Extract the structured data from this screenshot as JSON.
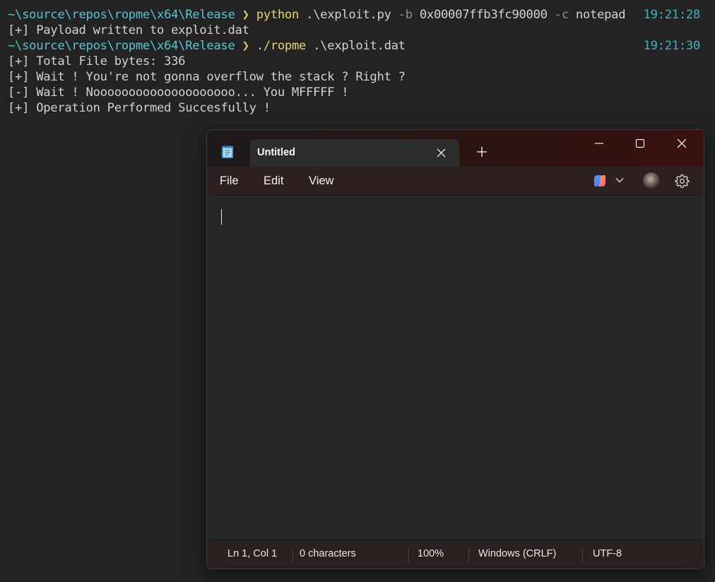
{
  "terminal": {
    "lines": [
      {
        "path": "~\\source\\repos\\ropme\\x64\\Release",
        "arrow": "❯",
        "cmd": "python",
        "args": " .\\exploit.py ",
        "flag1": "-b",
        "args2": " 0x00007ffb3fc90000 ",
        "flag2": "-c",
        "args3": " notepad",
        "time": "19:21:28"
      },
      {
        "text": "[+] Payload written to exploit.dat"
      },
      {
        "path": "~\\source\\repos\\ropme\\x64\\Release",
        "arrow": "❯",
        "cmd": "./ropme",
        "args": " .\\exploit.dat",
        "time": "19:21:30"
      },
      {
        "text": "[+] Total File bytes: 336"
      },
      {
        "text": "[+] Wait ! You're not gonna overflow the stack ? Right ?"
      },
      {
        "text": "[-] Wait ! Noooooooooooooooooooo... You MFFFFF !"
      },
      {
        "text": "[+] Operation Performed Succesfully !"
      }
    ]
  },
  "notepad": {
    "tab_title": "Untitled",
    "menu": {
      "file": "File",
      "edit": "Edit",
      "view": "View"
    },
    "editor_text": "",
    "status": {
      "position": "Ln 1, Col 1",
      "chars": "0 characters",
      "zoom": "100%",
      "line_ending": "Windows (CRLF)",
      "encoding": "UTF-8"
    },
    "icons": {
      "app": "notepad-icon",
      "close_tab": "close-icon",
      "new_tab": "plus-icon",
      "minimize": "minimize-icon",
      "maximize": "maximize-icon",
      "close": "close-icon",
      "copilot": "copilot-icon",
      "chevron": "chevron-down-icon",
      "settings": "gear-icon"
    },
    "colors": {
      "titlebar_accent": "#3a1210",
      "terminal_path": "#56c5d0",
      "terminal_time": "#3cb6c0",
      "terminal_cmd": "#e6d56a"
    }
  }
}
